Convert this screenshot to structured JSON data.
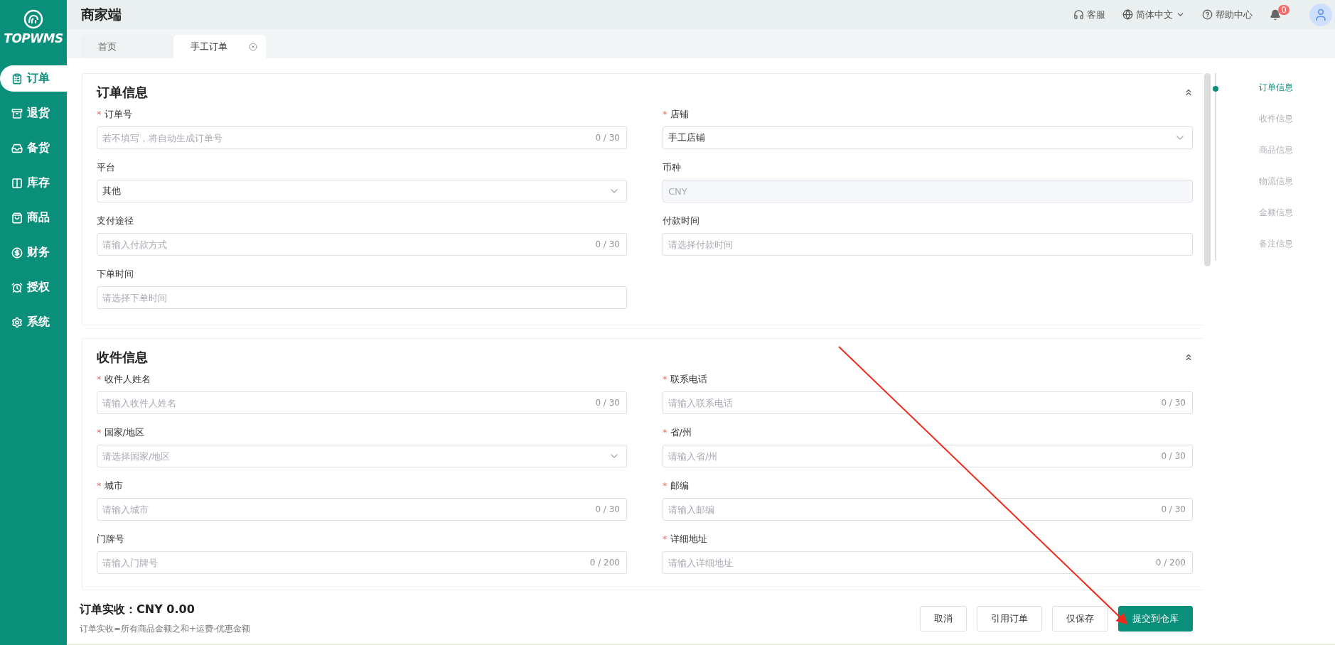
{
  "app": {
    "logo_text": "TOPWMS",
    "title": "商家端"
  },
  "sidebar": {
    "items": [
      {
        "label": "订单",
        "selected": true
      },
      {
        "label": "退货",
        "selected": false
      },
      {
        "label": "备货",
        "selected": false
      },
      {
        "label": "库存",
        "selected": false
      },
      {
        "label": "商品",
        "selected": false
      },
      {
        "label": "财务",
        "selected": false
      },
      {
        "label": "授权",
        "selected": false
      },
      {
        "label": "系统",
        "selected": false
      }
    ]
  },
  "header": {
    "service": "客服",
    "language": "简体中文",
    "help": "帮助中心",
    "notifications": "0"
  },
  "tabs": [
    {
      "label": "首页",
      "selected": false,
      "closable": false
    },
    {
      "label": "手工订单",
      "selected": true,
      "closable": true
    }
  ],
  "sections": [
    {
      "title": "订单信息",
      "fields": [
        {
          "label": "订单号",
          "required_mark": "*",
          "kind": "text",
          "placeholder": "若不填写，将自动生成订单号",
          "counter": "0 / 30"
        },
        {
          "label": "店铺",
          "required_mark": "*",
          "kind": "select",
          "value": "手工店铺"
        },
        {
          "label": "平台",
          "kind": "select",
          "value": "其他"
        },
        {
          "label": "币种",
          "kind": "disabled",
          "value": "CNY"
        },
        {
          "label": "支付途径",
          "kind": "text",
          "placeholder": "请输入付款方式",
          "counter": "0 / 30"
        },
        {
          "label": "付款时间",
          "kind": "text",
          "placeholder": "请选择付款时间"
        },
        {
          "label": "下单时间",
          "kind": "text",
          "placeholder": "请选择下单时间"
        }
      ]
    },
    {
      "title": "收件信息",
      "fields": [
        {
          "label": "收件人姓名",
          "required_mark": "*",
          "kind": "text",
          "placeholder": "请输入收件人姓名",
          "counter": "0 / 30"
        },
        {
          "label": "联系电话",
          "required_mark": "*",
          "kind": "text",
          "placeholder": "请输入联系电话",
          "counter": "0 / 30"
        },
        {
          "label": "国家/地区",
          "required_mark": "*",
          "kind": "select",
          "placeholder": "请选择国家/地区"
        },
        {
          "label": "省/州",
          "required_mark": "*",
          "kind": "text",
          "placeholder": "请输入省/州",
          "counter": "0 / 30"
        },
        {
          "label": "城市",
          "required_mark": "*",
          "kind": "text",
          "placeholder": "请输入城市",
          "counter": "0 / 30"
        },
        {
          "label": "邮编",
          "required_mark": "*",
          "kind": "text",
          "placeholder": "请输入邮编",
          "counter": "0 / 30"
        },
        {
          "label": "门牌号",
          "kind": "text",
          "placeholder": "请输入门牌号",
          "counter": "0 / 200"
        },
        {
          "label": "详细地址",
          "required_mark": "*",
          "kind": "text",
          "placeholder": "请输入详细地址",
          "counter": "0 / 200"
        }
      ]
    }
  ],
  "anchor_nav": [
    {
      "label": "订单信息",
      "selected": true
    },
    {
      "label": "收件信息",
      "selected": false
    },
    {
      "label": "商品信息",
      "selected": false
    },
    {
      "label": "物流信息",
      "selected": false
    },
    {
      "label": "金额信息",
      "selected": false
    },
    {
      "label": "备注信息",
      "selected": false
    }
  ],
  "footer": {
    "total": "订单实收：CNY 0.00",
    "formula": "订单实收=所有商品金额之和+运费-优惠金额",
    "buttons": [
      {
        "label": "取消",
        "kind": "default"
      },
      {
        "label": "引用订单",
        "kind": "default"
      },
      {
        "label": "仅保存",
        "kind": "default"
      },
      {
        "label": "提交到仓库",
        "kind": "primary"
      }
    ]
  }
}
